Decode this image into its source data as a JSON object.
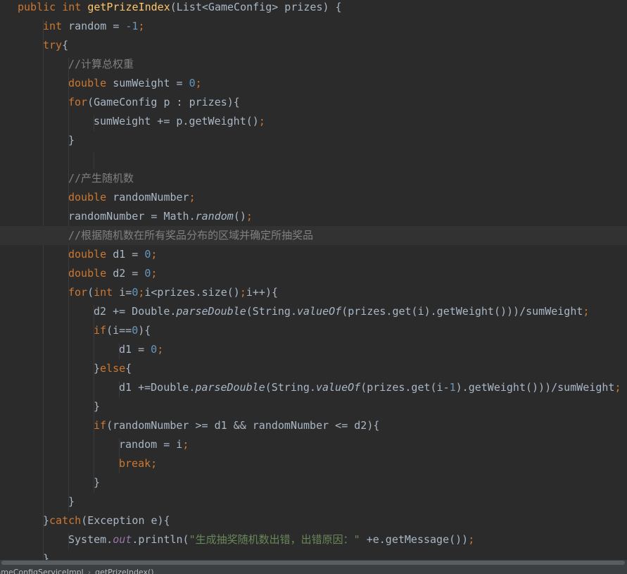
{
  "editor": {
    "lines": [
      {
        "indent": 0,
        "segs": [
          [
            "kw",
            "public int "
          ],
          [
            "fn",
            "getPrizeIndex"
          ],
          [
            "",
            "(List<GameConfig> prizes) {"
          ]
        ]
      },
      {
        "indent": 1,
        "segs": [
          [
            "kw",
            "int "
          ],
          [
            "",
            "random = "
          ],
          [
            "num",
            "-1"
          ],
          [
            "kw",
            ";"
          ]
        ]
      },
      {
        "indent": 1,
        "segs": [
          [
            "kw",
            "try"
          ],
          [
            "",
            "{"
          ]
        ]
      },
      {
        "indent": 2,
        "segs": [
          [
            "cmt",
            "//计算总权重"
          ]
        ]
      },
      {
        "indent": 2,
        "segs": [
          [
            "kw",
            "double "
          ],
          [
            "",
            "sumWeight = "
          ],
          [
            "num",
            "0"
          ],
          [
            "kw",
            ";"
          ]
        ]
      },
      {
        "indent": 2,
        "segs": [
          [
            "kw",
            "for"
          ],
          [
            "",
            "(GameConfig p : prizes){"
          ]
        ]
      },
      {
        "indent": 3,
        "segs": [
          [
            "",
            "sumWeight += p.getWeight()"
          ],
          [
            "kw",
            ";"
          ]
        ]
      },
      {
        "indent": 2,
        "segs": [
          [
            "",
            "}"
          ]
        ]
      },
      {
        "indent": 0,
        "segs": []
      },
      {
        "indent": 2,
        "segs": [
          [
            "cmt",
            "//产生随机数"
          ]
        ]
      },
      {
        "indent": 2,
        "segs": [
          [
            "kw",
            "double "
          ],
          [
            "",
            "randomNumber"
          ],
          [
            "kw",
            ";"
          ]
        ]
      },
      {
        "indent": 2,
        "segs": [
          [
            "",
            "randomNumber = Math."
          ],
          [
            "ital",
            "random"
          ],
          [
            "",
            "()"
          ],
          [
            "kw",
            ";"
          ]
        ]
      },
      {
        "indent": 2,
        "current": true,
        "segs": [
          [
            "cmt",
            "//根据随机数在所有奖品分布的区域并确定所抽奖品"
          ]
        ]
      },
      {
        "indent": 2,
        "segs": [
          [
            "kw",
            "double "
          ],
          [
            "",
            "d1 = "
          ],
          [
            "num",
            "0"
          ],
          [
            "kw",
            ";"
          ]
        ]
      },
      {
        "indent": 2,
        "segs": [
          [
            "kw",
            "double "
          ],
          [
            "",
            "d2 = "
          ],
          [
            "num",
            "0"
          ],
          [
            "kw",
            ";"
          ]
        ]
      },
      {
        "indent": 2,
        "segs": [
          [
            "kw",
            "for"
          ],
          [
            "",
            "("
          ],
          [
            "kw",
            "int "
          ],
          [
            "",
            "i="
          ],
          [
            "num",
            "0"
          ],
          [
            "kw",
            ";"
          ],
          [
            "",
            "i<prizes.size()"
          ],
          [
            "kw",
            ";"
          ],
          [
            "",
            "i++){"
          ]
        ]
      },
      {
        "indent": 3,
        "segs": [
          [
            "",
            "d2 += Double."
          ],
          [
            "ital",
            "parseDouble"
          ],
          [
            "",
            "(String."
          ],
          [
            "ital",
            "valueOf"
          ],
          [
            "",
            "(prizes.get(i).getWeight()))/sumWeight"
          ],
          [
            "kw",
            ";"
          ]
        ]
      },
      {
        "indent": 3,
        "segs": [
          [
            "kw",
            "if"
          ],
          [
            "",
            "(i=="
          ],
          [
            "num",
            "0"
          ],
          [
            "",
            "){"
          ]
        ]
      },
      {
        "indent": 4,
        "segs": [
          [
            "",
            "d1 = "
          ],
          [
            "num",
            "0"
          ],
          [
            "kw",
            ";"
          ]
        ]
      },
      {
        "indent": 3,
        "segs": [
          [
            "",
            "}"
          ],
          [
            "kw",
            "else"
          ],
          [
            "",
            "{"
          ]
        ]
      },
      {
        "indent": 4,
        "segs": [
          [
            "",
            "d1 +=Double."
          ],
          [
            "ital",
            "parseDouble"
          ],
          [
            "",
            "(String."
          ],
          [
            "ital",
            "valueOf"
          ],
          [
            "",
            "(prizes.get(i-"
          ],
          [
            "num",
            "1"
          ],
          [
            "",
            ").getWeight()))/sumWeight"
          ],
          [
            "kw",
            ";"
          ]
        ]
      },
      {
        "indent": 3,
        "segs": [
          [
            "",
            "}"
          ]
        ]
      },
      {
        "indent": 3,
        "segs": [
          [
            "kw",
            "if"
          ],
          [
            "",
            "(randomNumber >= d1 && randomNumber <= d2){"
          ]
        ]
      },
      {
        "indent": 4,
        "segs": [
          [
            "",
            "random = i"
          ],
          [
            "kw",
            ";"
          ]
        ]
      },
      {
        "indent": 4,
        "segs": [
          [
            "kw",
            "break;"
          ]
        ]
      },
      {
        "indent": 3,
        "segs": [
          [
            "",
            "}"
          ]
        ]
      },
      {
        "indent": 2,
        "segs": [
          [
            "",
            "}"
          ]
        ]
      },
      {
        "indent": 1,
        "segs": [
          [
            "",
            "}"
          ],
          [
            "kw",
            "catch"
          ],
          [
            "",
            "(Exception e){"
          ]
        ]
      },
      {
        "indent": 2,
        "segs": [
          [
            "",
            "System."
          ],
          [
            "field",
            "out"
          ],
          [
            "",
            ".println("
          ],
          [
            "str",
            "\"生成抽奖随机数出错，出错原因：\" "
          ],
          [
            "",
            "+e.getMessage())"
          ],
          [
            "kw",
            ";"
          ]
        ]
      },
      {
        "indent": 1,
        "segs": [
          [
            "",
            "}"
          ]
        ]
      }
    ]
  },
  "breadcrumb": {
    "class_name": "GameConfigServiceImpl",
    "separator": "›",
    "method_name": "getPrizeIndex()"
  }
}
